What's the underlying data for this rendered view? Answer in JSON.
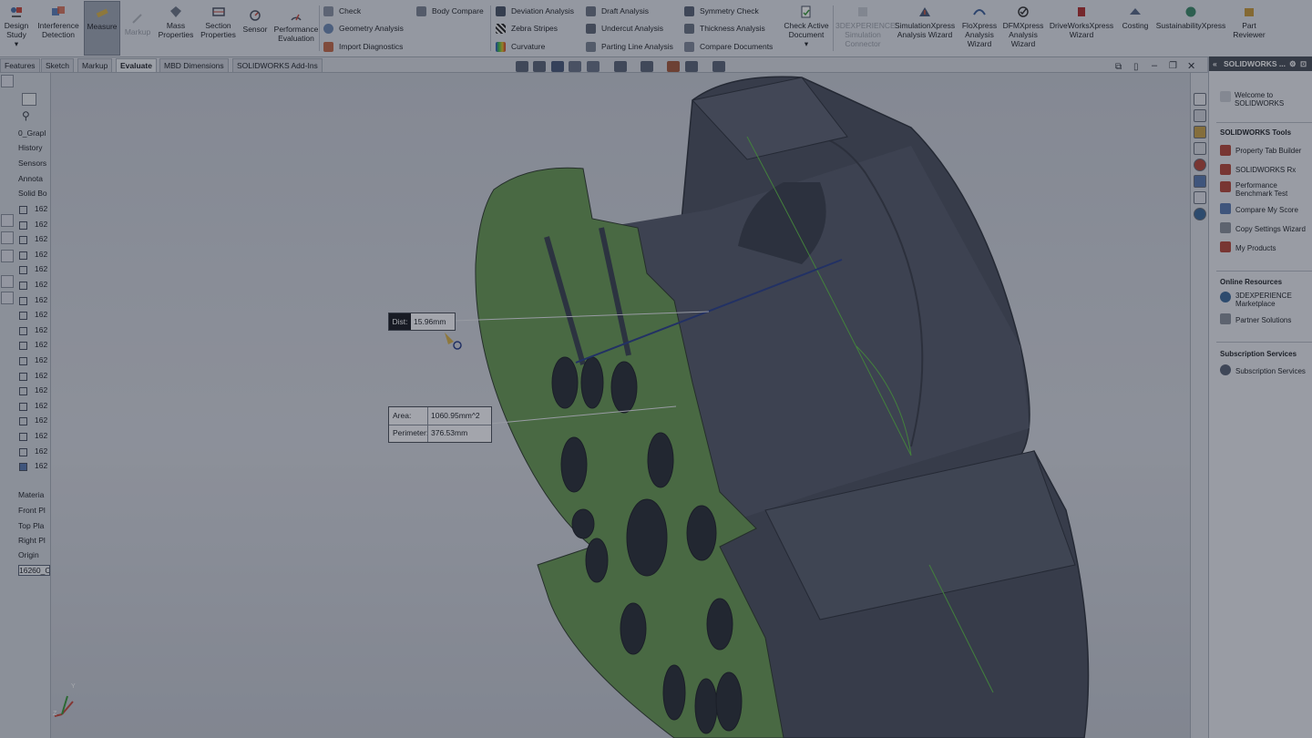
{
  "ribbon": {
    "big_buttons": [
      {
        "label": "Design Study",
        "icon": "design-study-icon"
      },
      {
        "label": "Interference Detection",
        "icon": "interference-icon"
      },
      {
        "label": "Measure",
        "icon": "measure-icon"
      },
      {
        "label": "Markup",
        "icon": "markup-icon"
      },
      {
        "label": "Mass Properties",
        "icon": "mass-properties-icon"
      },
      {
        "label": "Section Properties",
        "icon": "section-properties-icon"
      },
      {
        "label": "Sensor",
        "icon": "sensor-icon"
      },
      {
        "label": "Performance Evaluation",
        "icon": "performance-icon"
      }
    ],
    "small_col1": [
      {
        "label": "Check",
        "icon": "check-icon"
      },
      {
        "label": "Geometry Analysis",
        "icon": "geometry-analysis-icon"
      },
      {
        "label": "Import Diagnostics",
        "icon": "import-diagnostics-icon"
      }
    ],
    "body_compare": "Body Compare",
    "small_col2": [
      {
        "label": "Deviation Analysis",
        "icon": "deviation-icon"
      },
      {
        "label": "Zebra Stripes",
        "icon": "zebra-icon"
      },
      {
        "label": "Curvature",
        "icon": "curvature-icon"
      }
    ],
    "small_col3": [
      {
        "label": "Draft Analysis",
        "icon": "draft-icon"
      },
      {
        "label": "Undercut Analysis",
        "icon": "undercut-icon"
      },
      {
        "label": "Parting Line Analysis",
        "icon": "parting-line-icon"
      }
    ],
    "small_col4": [
      {
        "label": "Symmetry Check",
        "icon": "symmetry-icon"
      },
      {
        "label": "Thickness Analysis",
        "icon": "thickness-icon"
      },
      {
        "label": "Compare Documents",
        "icon": "compare-docs-icon"
      }
    ],
    "check_active_document": "Check Active Document",
    "right_buttons": [
      {
        "label": "3DEXPERIENCE Simulation Connector",
        "icon": "3dexperience-sim-icon"
      },
      {
        "label": "SimulationXpress Analysis Wizard",
        "icon": "simulationxpress-icon"
      },
      {
        "label": "FloXpress Analysis Wizard",
        "icon": "floxpress-icon"
      },
      {
        "label": "DFMXpress Analysis Wizard",
        "icon": "dfmxpress-icon"
      },
      {
        "label": "DriveWorksXpress Wizard",
        "icon": "driveworksxpress-icon"
      },
      {
        "label": "Costing",
        "icon": "costing-icon"
      },
      {
        "label": "SustainabilityXpress",
        "icon": "sustainability-icon"
      },
      {
        "label": "Part Reviewer",
        "icon": "part-reviewer-icon"
      }
    ]
  },
  "tabs": [
    "Features",
    "Sketch",
    "Markup",
    "Evaluate",
    "MBD Dimensions",
    "SOLIDWORKS Add-Ins"
  ],
  "active_tab": "Evaluate",
  "tree": {
    "root": "0_Grapl",
    "items": [
      "History",
      "Sensors",
      "Annota",
      "Solid Bo"
    ],
    "numbered": [
      "162",
      "162",
      "162",
      "162",
      "162",
      "162",
      "162",
      "162",
      "162",
      "162",
      "162",
      "162",
      "162",
      "162",
      "162",
      "162",
      "162",
      "162"
    ],
    "bottom": [
      "Materia",
      "Front Pl",
      "Top Pla",
      "Right Pl",
      "Origin"
    ],
    "last": "16260_C"
  },
  "measure": {
    "dist_label": "Dist:",
    "dist_value": "15.96mm",
    "area_label": "Area:",
    "area_value": "1060.95mm^2",
    "perimeter_label": "Perimeter:",
    "perimeter_value": "376.53mm"
  },
  "task_pane": {
    "title": "SOLIDWORKS ...",
    "welcome": "Welcome to SOLIDWORKS",
    "tools_heading": "SOLIDWORKS Tools",
    "tools": [
      "Property Tab Builder",
      "SOLIDWORKS Rx",
      "Performance Benchmark Test",
      "Compare My Score",
      "Copy Settings Wizard",
      "My Products"
    ],
    "online_heading": "Online Resources",
    "online": [
      "3DEXPERIENCE Marketplace",
      "Partner Solutions"
    ],
    "subscription_heading": "Subscription Services",
    "subscription": [
      "Subscription Services"
    ]
  },
  "triad": {
    "x": "X",
    "y": "Y",
    "z": "Z"
  },
  "colors": {
    "face_green": "#6a9a55",
    "body_gray": "#4c5160",
    "ribbon_bg": "#e3e6ec",
    "measure_line": "#2b3f8a"
  }
}
